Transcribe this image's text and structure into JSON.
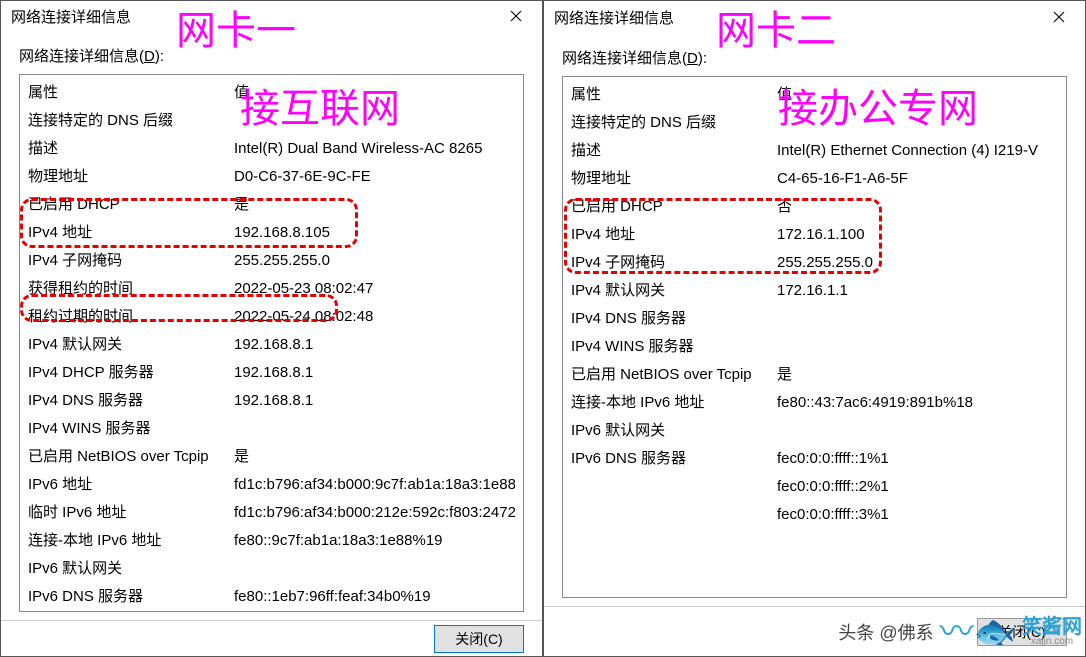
{
  "annotations": {
    "card1_title": "网卡一",
    "card1_sub": "接互联网",
    "card2_title": "网卡二",
    "card2_sub": "接办公专网"
  },
  "watermark": {
    "line1": "头条 @佛系",
    "brand_cn": "笑酱网",
    "brand_en": "xajjn.com"
  },
  "dialogs": [
    {
      "title": "网络连接详细信息",
      "sub_header_pre": "网络连接详细信息(",
      "sub_header_key": "D",
      "sub_header_post": "):",
      "header_prop": "属性",
      "header_val": "值",
      "close_label": "关闭(C)",
      "rows": [
        {
          "prop": "连接特定的 DNS 后缀",
          "val": ""
        },
        {
          "prop": "描述",
          "val": "Intel(R) Dual Band Wireless-AC 8265"
        },
        {
          "prop": "物理地址",
          "val": "D0-C6-37-6E-9C-FE"
        },
        {
          "prop": "已启用 DHCP",
          "val": "是"
        },
        {
          "prop": "IPv4 地址",
          "val": "192.168.8.105"
        },
        {
          "prop": "IPv4 子网掩码",
          "val": "255.255.255.0"
        },
        {
          "prop": "获得租约的时间",
          "val": "2022-05-23 08:02:47"
        },
        {
          "prop": "租约过期的时间",
          "val": "2022-05-24 08:02:48"
        },
        {
          "prop": "IPv4 默认网关",
          "val": "192.168.8.1"
        },
        {
          "prop": "IPv4 DHCP 服务器",
          "val": "192.168.8.1"
        },
        {
          "prop": "IPv4 DNS 服务器",
          "val": "192.168.8.1"
        },
        {
          "prop": "IPv4 WINS 服务器",
          "val": ""
        },
        {
          "prop": "已启用 NetBIOS over Tcpip",
          "val": "是"
        },
        {
          "prop": "IPv6 地址",
          "val": "fd1c:b796:af34:b000:9c7f:ab1a:18a3:1e88"
        },
        {
          "prop": "临时 IPv6 地址",
          "val": "fd1c:b796:af34:b000:212e:592c:f803:2472"
        },
        {
          "prop": "连接-本地 IPv6 地址",
          "val": "fe80::9c7f:ab1a:18a3:1e88%19"
        },
        {
          "prop": "IPv6 默认网关",
          "val": ""
        },
        {
          "prop": "IPv6 DNS 服务器",
          "val": "fe80::1eb7:96ff:feaf:34b0%19"
        }
      ]
    },
    {
      "title": "网络连接详细信息",
      "sub_header_pre": "网络连接详细信息(",
      "sub_header_key": "D",
      "sub_header_post": "):",
      "header_prop": "属性",
      "header_val": "值",
      "close_label": "关闭(C)",
      "rows": [
        {
          "prop": "连接特定的 DNS 后缀",
          "val": ""
        },
        {
          "prop": "描述",
          "val": "Intel(R) Ethernet Connection (4) I219-V"
        },
        {
          "prop": "物理地址",
          "val": "C4-65-16-F1-A6-5F"
        },
        {
          "prop": "已启用 DHCP",
          "val": "否"
        },
        {
          "prop": "IPv4 地址",
          "val": "172.16.1.100"
        },
        {
          "prop": "IPv4 子网掩码",
          "val": "255.255.255.0"
        },
        {
          "prop": "IPv4 默认网关",
          "val": "172.16.1.1"
        },
        {
          "prop": "IPv4 DNS 服务器",
          "val": ""
        },
        {
          "prop": "IPv4 WINS 服务器",
          "val": ""
        },
        {
          "prop": "已启用 NetBIOS over Tcpip",
          "val": "是"
        },
        {
          "prop": "连接-本地 IPv6 地址",
          "val": "fe80::43:7ac6:4919:891b%18"
        },
        {
          "prop": "IPv6 默认网关",
          "val": ""
        },
        {
          "prop": "IPv6 DNS 服务器",
          "val": "fec0:0:0:ffff::1%1"
        },
        {
          "prop": "",
          "val": "fec0:0:0:ffff::2%1"
        },
        {
          "prop": "",
          "val": "fec0:0:0:ffff::3%1"
        }
      ]
    }
  ]
}
